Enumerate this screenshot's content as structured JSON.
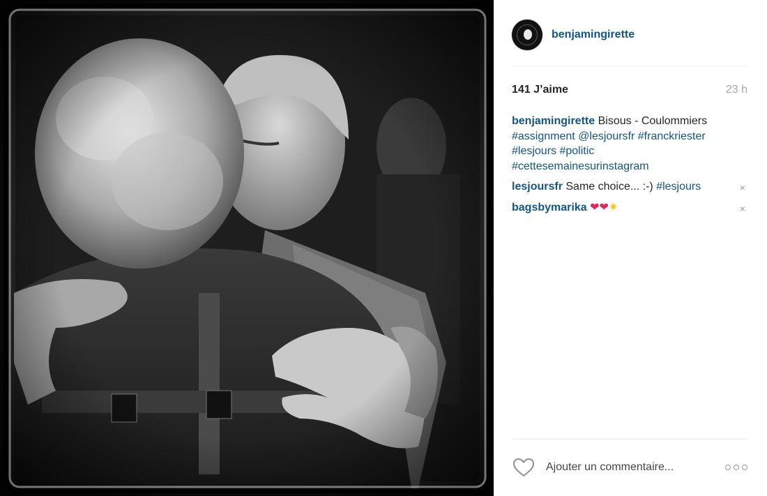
{
  "post": {
    "author": "benjamingirette",
    "likes_text": "141 J’aime",
    "time_text": "23 h"
  },
  "caption": {
    "user": "benjamingirette",
    "text": "Bisous - Coulommiers",
    "tags": [
      "#assignment",
      "@lesjoursfr",
      "#franckriester",
      "#lesjours",
      "#politic",
      "#cettesemainesurinstagram"
    ]
  },
  "comments": [
    {
      "user": "lesjoursfr",
      "text": "Same choice... :-)",
      "tag": "#lesjours"
    },
    {
      "user": "bagsbymarika",
      "emojis": [
        "❤",
        "❤",
        "✷"
      ]
    }
  ],
  "footer": {
    "comment_placeholder": "Ajouter un commentaire..."
  },
  "icons": {
    "remove": "×",
    "like": "heart-outline-icon",
    "more": "more-options-icon"
  },
  "colors": {
    "link": "#125688",
    "text": "#262626",
    "muted": "#a5a7aa"
  }
}
